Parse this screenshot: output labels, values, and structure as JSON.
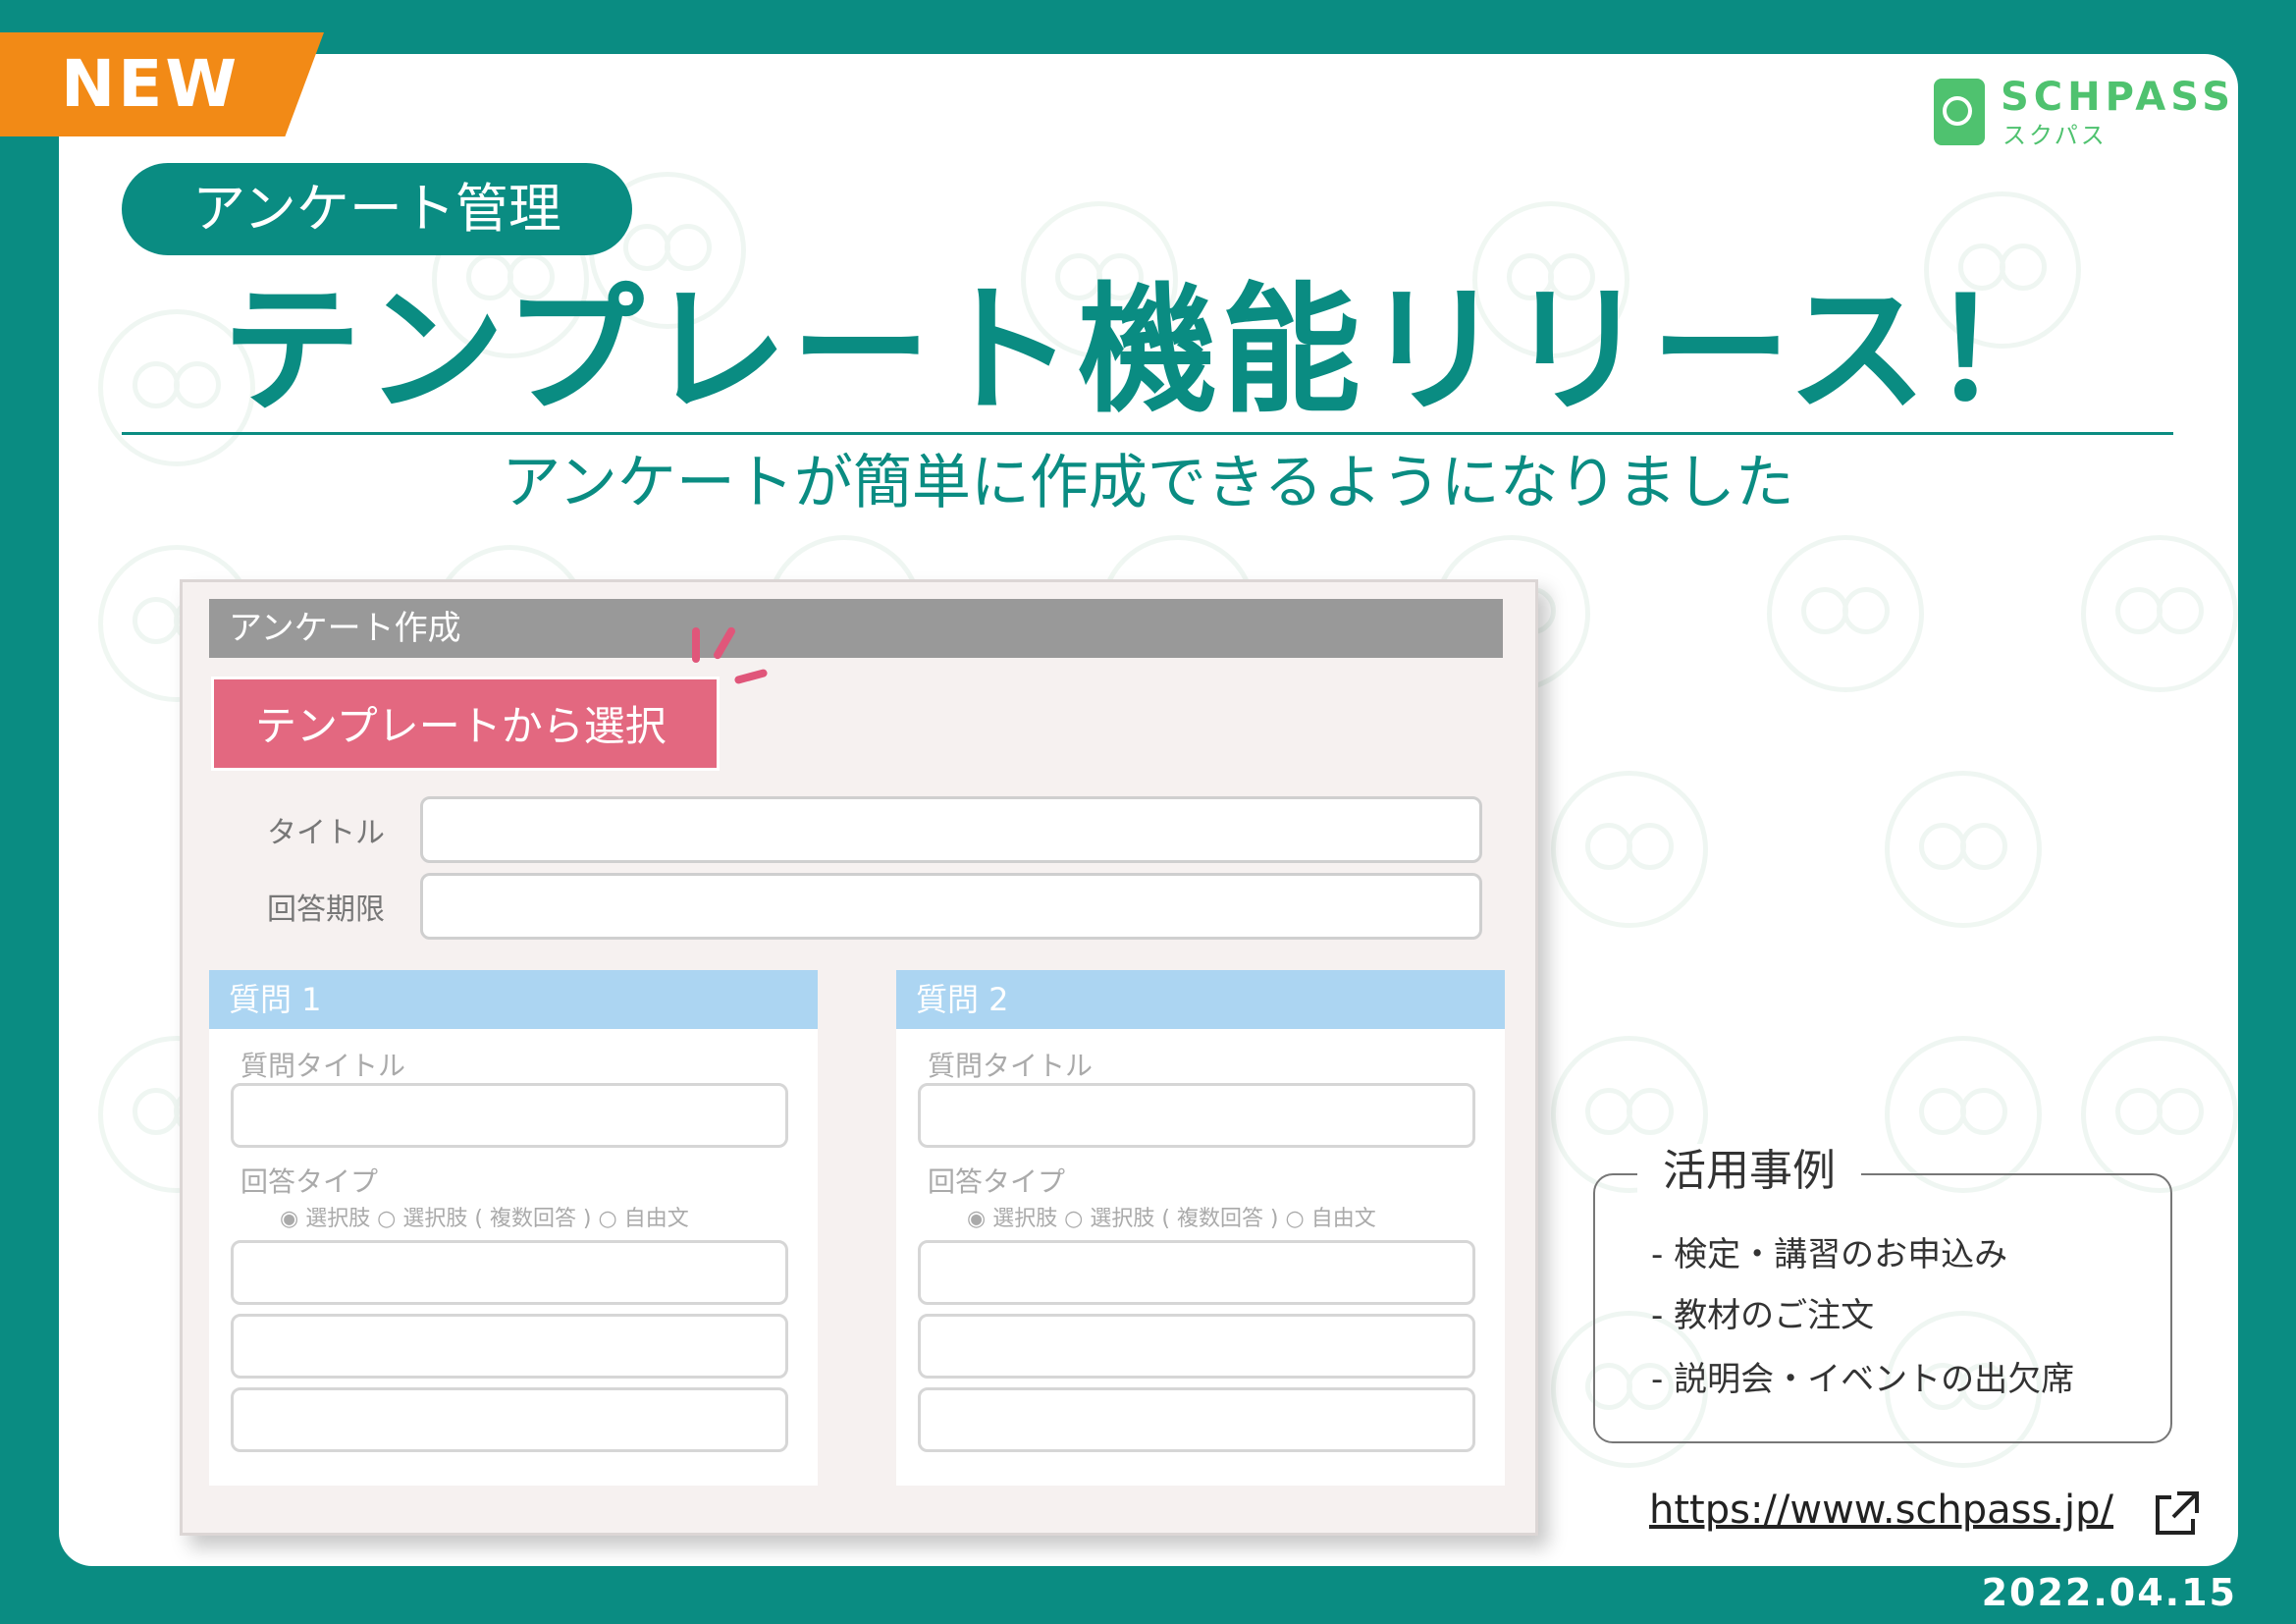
{
  "badge": {
    "new_label": "NEW"
  },
  "logo": {
    "name": "SCHPASS",
    "kana": "スクパス"
  },
  "category_pill": "アンケート管理",
  "headline": "テンプレート機能リリース！",
  "subheadline": "アンケートが簡単に作成できるようになりました",
  "mock_form": {
    "title": "アンケート作成",
    "template_button": "テンプレートから選択",
    "fields": [
      {
        "label": "タイトル",
        "value": ""
      },
      {
        "label": "回答期限",
        "value": ""
      }
    ],
    "questions": [
      {
        "header": "質問 1",
        "title_label": "質問タイトル",
        "type_label": "回答タイプ",
        "answer_options": "◉ 選択肢 ○ 選択肢 ( 複数回答 ) ○ 自由文"
      },
      {
        "header": "質問 2",
        "title_label": "質問タイトル",
        "type_label": "回答タイプ",
        "answer_options": "◉ 選択肢 ○ 選択肢 ( 複数回答 ) ○ 自由文"
      }
    ]
  },
  "use_cases": {
    "title": "活用事例",
    "items": [
      "- 検定・講習のお申込み",
      "- 教材のご注文",
      "- 説明会・イベントの出欠席"
    ]
  },
  "url": "https://www.schpass.jp/",
  "date": "2022.04.15",
  "colors": {
    "brand_teal": "#0a8c82",
    "badge_orange": "#f28a16",
    "logo_green": "#4fc26f",
    "button_pink": "#e36880",
    "question_header_blue": "#acd5f2"
  },
  "icons": {
    "external_link": "external-link-icon",
    "logo": "schpass-logo-icon"
  }
}
